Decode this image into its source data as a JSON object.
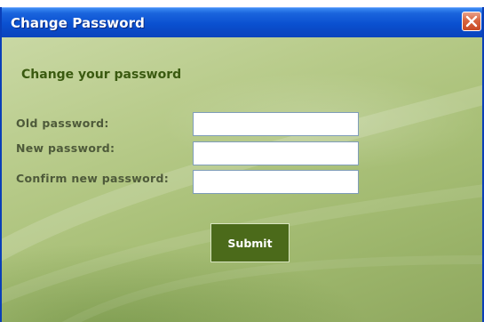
{
  "window": {
    "title": "Change Password"
  },
  "form": {
    "heading": "Change your password",
    "old_password_label": "Old password:",
    "new_password_label": "New password:",
    "confirm_password_label": "Confirm new password:",
    "old_password_value": "",
    "new_password_value": "",
    "confirm_password_value": "",
    "submit_label": "Submit"
  },
  "colors": {
    "titlebar": "#0a50d0",
    "close_button": "#d8653f",
    "background": "#b9cc8c",
    "heading_text": "#3a5a10",
    "submit_button": "#4b6a1a"
  },
  "icons": {
    "close": "close-icon"
  }
}
